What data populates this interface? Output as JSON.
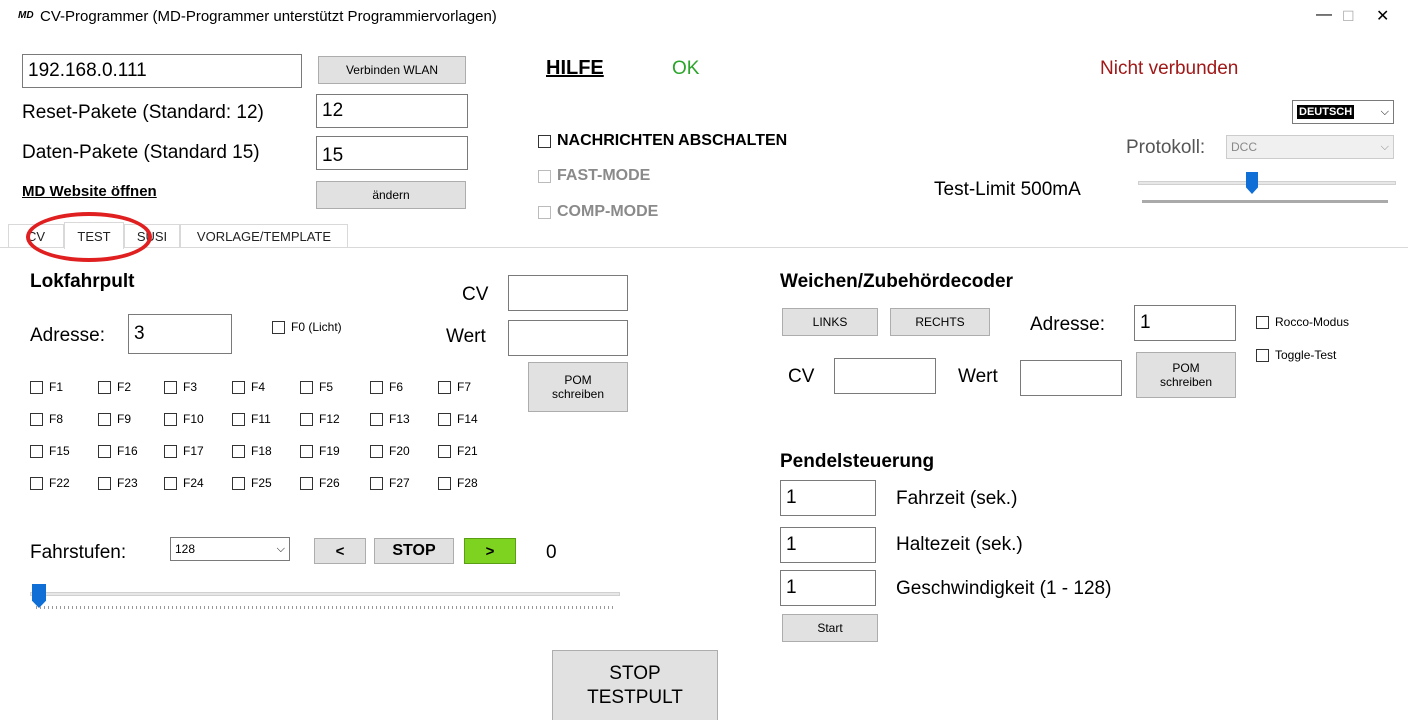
{
  "window": {
    "logo": "MD",
    "title": "CV-Programmer (MD-Programmer unterstützt Programmiervorlagen)",
    "minimize": "—",
    "maximize": "☐",
    "close": "✕"
  },
  "top": {
    "ip_value": "192.168.0.111",
    "connect_wlan": "Verbinden WLAN",
    "hilfe": "HILFE",
    "ok_status": "OK",
    "connection_status": "Nicht verbunden",
    "reset_label": "Reset-Pakete (Standard: 12)",
    "reset_value": "12",
    "daten_label": "Daten-Pakete (Standard 15)",
    "daten_value": "15",
    "website_link": "MD Website öffnen",
    "aendern_button": "ändern",
    "language": "DEUTSCH",
    "nachrichten_abschalten": "NACHRICHTEN ABSCHALTEN",
    "fast_mode": "FAST-MODE",
    "comp_mode": "COMP-MODE",
    "protokoll_label": "Protokoll:",
    "protokoll_value": "DCC",
    "test_limit": "Test-Limit 500mA",
    "test_limit_slider_fraction": 0.44
  },
  "tabs": [
    "CV",
    "TEST",
    "SUSI",
    "VORLAGE/TEMPLATE"
  ],
  "lok": {
    "title": "Lokfahrpult",
    "adresse_label": "Adresse:",
    "adresse_value": "3",
    "f0_label": "F0 (Licht)",
    "cv_label": "CV",
    "wert_label": "Wert",
    "pom_button": [
      "POM",
      "schreiben"
    ],
    "functions": [
      [
        "F1",
        "F2",
        "F3",
        "F4",
        "F5",
        "F6",
        "F7"
      ],
      [
        "F8",
        "F9",
        "F10",
        "F11",
        "F12",
        "F13",
        "F14"
      ],
      [
        "F15",
        "F16",
        "F17",
        "F18",
        "F19",
        "F20",
        "F21"
      ],
      [
        "F22",
        "F23",
        "F24",
        "F25",
        "F26",
        "F27",
        "F28"
      ]
    ],
    "fahrstufen_label": "Fahrstufen:",
    "fahrstufen_value": "128",
    "back_button": "<",
    "stop_button": "STOP",
    "forward_button": ">",
    "speed_value": "0",
    "speed_slider_fraction": 0
  },
  "weichen": {
    "title": "Weichen/Zubehördecoder",
    "links_button": "LINKS",
    "rechts_button": "RECHTS",
    "adresse_label": "Adresse:",
    "adresse_value": "1",
    "roco_modus": "Rocco-Modus",
    "toggle_test": "Toggle-Test",
    "cv_label": "CV",
    "wert_label": "Wert",
    "pom_button": [
      "POM",
      "schreiben"
    ]
  },
  "pendel": {
    "title": "Pendelsteuerung",
    "fahrzeit_value": "1",
    "fahrzeit_label": "Fahrzeit (sek.)",
    "haltezeit_value": "1",
    "haltezeit_label": "Haltezeit (sek.)",
    "geschw_value": "1",
    "geschw_label": "Geschwindigkeit (1 - 128)",
    "start_button": "Start"
  },
  "stop_testpult": [
    "STOP",
    "TESTPULT"
  ],
  "colors": {
    "ok_green": "#2aa52a",
    "status_red": "#a01818",
    "annotation_red": "#e02020",
    "forward_green": "#7ed321",
    "slider_blue": "#0f6fd6"
  }
}
